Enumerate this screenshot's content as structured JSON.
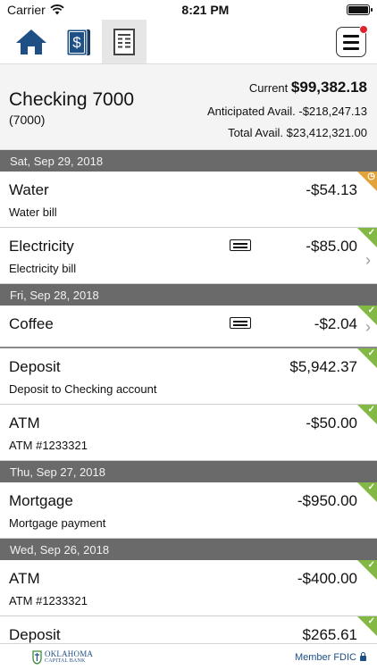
{
  "status": {
    "carrier": "Carrier",
    "time": "8:21 PM"
  },
  "nav": {
    "tabs": [
      {
        "name": "home",
        "icon": "home-icon"
      },
      {
        "name": "transfer",
        "icon": "money-icon"
      },
      {
        "name": "transactions",
        "icon": "document-icon",
        "active": true
      }
    ],
    "menu_icon": "hamburger-menu-icon"
  },
  "account": {
    "name": "Checking 7000",
    "number": "(7000)",
    "current_label": "Current",
    "current_amount": "$99,382.18",
    "anticipated_label": "Anticipated Avail.",
    "anticipated_amount": "-$218,247.13",
    "total_label": "Total Avail.",
    "total_amount": "$23,412,321.00"
  },
  "groups": [
    {
      "date": "Sat, Sep 29, 2018",
      "items": [
        {
          "name": "Water",
          "description": "Water bill",
          "amount": "-$54.13",
          "status": "pending"
        },
        {
          "name": "Electricity",
          "description": "Electricity bill",
          "amount": "-$85.00",
          "status": "cleared",
          "receipt": true,
          "chevron": true
        }
      ]
    },
    {
      "date": "Fri, Sep 28, 2018",
      "items": [
        {
          "name": "Coffee",
          "description": "",
          "amount": "-$2.04",
          "status": "cleared",
          "receipt": true,
          "chevron": true
        },
        {
          "name": "Deposit",
          "description": "Deposit to Checking account",
          "amount": "$5,942.37",
          "status": "cleared"
        },
        {
          "name": "ATM",
          "description": "ATM #1233321",
          "amount": "-$50.00",
          "status": "cleared"
        }
      ]
    },
    {
      "date": "Thu, Sep 27, 2018",
      "items": [
        {
          "name": "Mortgage",
          "description": "Mortgage payment",
          "amount": "-$950.00",
          "status": "cleared"
        }
      ]
    },
    {
      "date": "Wed, Sep 26, 2018",
      "items": [
        {
          "name": "ATM",
          "description": "ATM #1233321",
          "amount": "-$400.00",
          "status": "cleared"
        },
        {
          "name": "Deposit",
          "description": "",
          "amount": "$265.61",
          "status": "cleared"
        }
      ]
    }
  ],
  "footer": {
    "bank_name_line1": "OKLAHOMA",
    "bank_name_line2": "CAPITAL BANK",
    "fdic": "Member FDIC"
  },
  "colors": {
    "cleared": "#84b844",
    "pending": "#e4a23a",
    "date_header": "#6a6a6a",
    "brand": "#1e4f85"
  }
}
